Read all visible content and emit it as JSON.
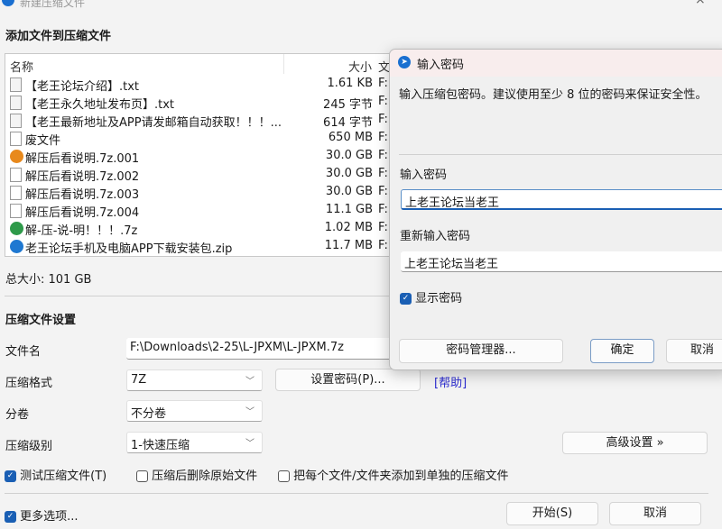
{
  "window": {
    "title": "新建压缩文件",
    "close_icon": "×"
  },
  "section_add": "添加文件到压缩文件",
  "list": {
    "headers": {
      "name": "名称",
      "size": "大小",
      "path": "文"
    },
    "rows": [
      {
        "icon": "text-file",
        "name": "【老王论坛介绍】.txt",
        "size": "1.61 KB",
        "path": "F:"
      },
      {
        "icon": "text-file",
        "name": "【老王永久地址发布页】.txt",
        "size": "245 字节",
        "path": "F:"
      },
      {
        "icon": "text-file",
        "name": "【老王最新地址及APP请发邮箱自动获取！！！...",
        "size": "614 字节",
        "path": "F:"
      },
      {
        "icon": "blank-file",
        "name": "废文件",
        "size": "650 MB",
        "path": "F:"
      },
      {
        "icon": "archive-001",
        "name": "解压后看说明.7z.001",
        "size": "30.0 GB",
        "path": "F:"
      },
      {
        "icon": "blank-file",
        "name": "解压后看说明.7z.002",
        "size": "30.0 GB",
        "path": "F:"
      },
      {
        "icon": "blank-file",
        "name": "解压后看说明.7z.003",
        "size": "30.0 GB",
        "path": "F:"
      },
      {
        "icon": "blank-file",
        "name": "解压后看说明.7z.004",
        "size": "11.1 GB",
        "path": "F:"
      },
      {
        "icon": "archive-7z",
        "name": "解-压-说-明！！！.7z",
        "size": "1.02 MB",
        "path": "F:"
      },
      {
        "icon": "archive-zip",
        "name": "老王论坛手机及电脑APP下载安装包.zip",
        "size": "11.7 MB",
        "path": "F:"
      }
    ]
  },
  "total_size": "总大小: 101 GB",
  "settings": {
    "heading": "压缩文件设置",
    "filename_label": "文件名",
    "filename_value": "F:\\Downloads\\2-25\\L-JPXM\\L-JPXM.7z",
    "format_label": "压缩格式",
    "format_value": "7Z",
    "set_password": "设置密码(P)...",
    "help": "[帮助]",
    "split_label": "分卷",
    "split_value": "不分卷",
    "level_label": "压缩级别",
    "level_value": "1-快速压缩",
    "advanced": "高级设置 »",
    "test": "测试压缩文件(T)",
    "test_checked": true,
    "delete_after": "压缩后删除原始文件",
    "delete_checked": false,
    "separate": "把每个文件/文件夹添加到单独的压缩文件",
    "separate_checked": false,
    "more": "更多选项...",
    "more_checked": true,
    "start": "开始(S)",
    "cancel": "取消"
  },
  "dialog": {
    "title": "输入密码",
    "description": "输入压缩包密码。建议使用至少 8 位的密码来保证安全性。",
    "password_label": "输入密码",
    "password_value": "上老王论坛当老王",
    "confirm_label": "重新输入密码",
    "confirm_value": "上老王论坛当老王",
    "show_password": "显示密码",
    "show_checked": true,
    "manager": "密码管理器...",
    "ok": "确定",
    "cancel": "取消"
  },
  "colors": {
    "accent": "#1a5fb4",
    "link": "#2b2bd0",
    "archive_orange": "#e8891c",
    "archive_green": "#2e9a4a",
    "archive_blue": "#1f78d1"
  }
}
